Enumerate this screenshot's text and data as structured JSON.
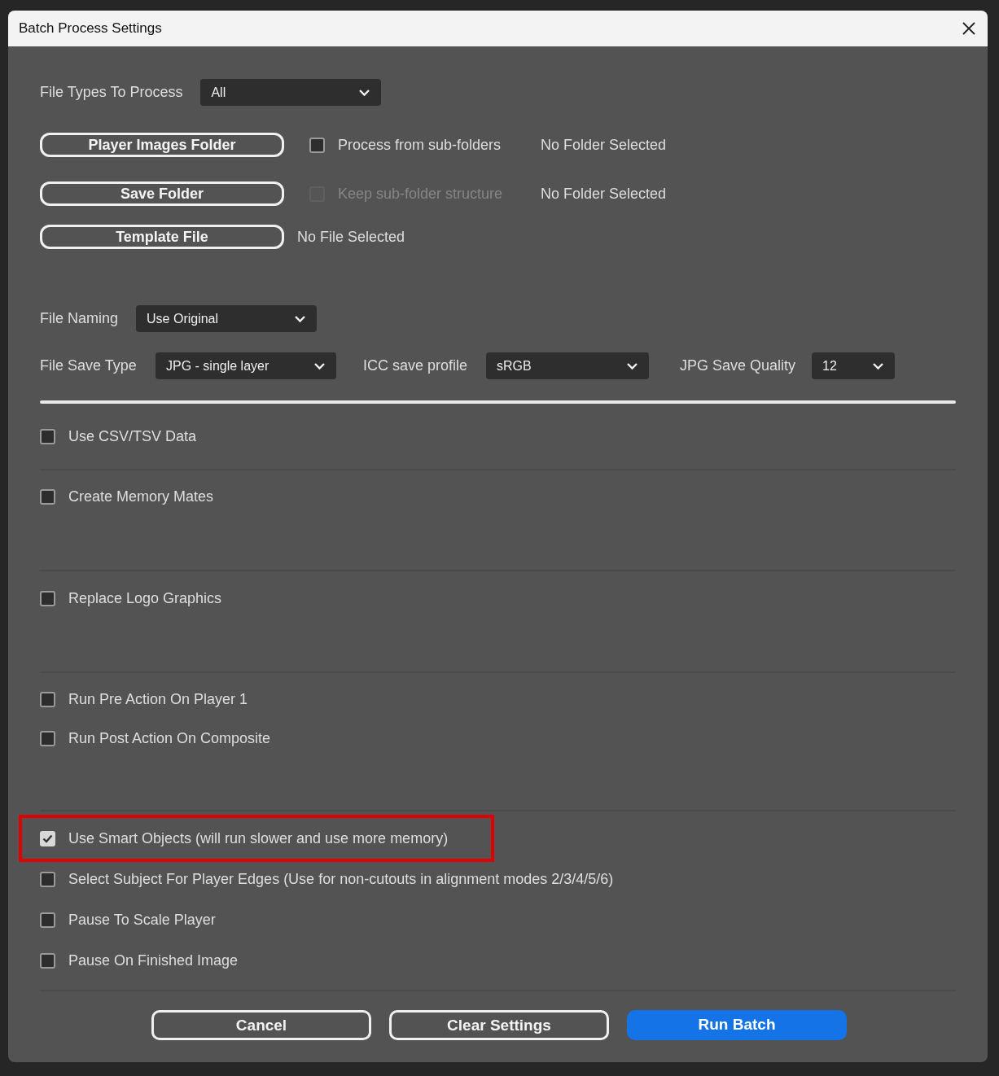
{
  "window": {
    "title": "Batch Process Settings"
  },
  "file_types": {
    "label": "File Types To Process",
    "value": "All"
  },
  "folder_rows": [
    {
      "button": "Player Images Folder",
      "checkbox": {
        "label": "Process from sub-folders",
        "checked": false,
        "disabled": false
      },
      "status": "No Folder Selected"
    },
    {
      "button": "Save Folder",
      "checkbox": {
        "label": "Keep sub-folder structure",
        "checked": false,
        "disabled": true
      },
      "status": "No Folder Selected"
    },
    {
      "button": "Template File",
      "status": "No File Selected"
    }
  ],
  "file_naming": {
    "label": "File Naming",
    "value": "Use Original"
  },
  "save_settings": [
    {
      "label": "File Save Type",
      "value": "JPG - single layer"
    },
    {
      "label": "ICC save profile",
      "value": "sRGB"
    },
    {
      "label": "JPG Save Quality",
      "value": "12"
    }
  ],
  "option_groups": [
    {
      "options": [
        {
          "label": "Use CSV/TSV Data",
          "checked": false,
          "highlighted": false
        }
      ]
    },
    {
      "options": [
        {
          "label": "Create Memory Mates",
          "checked": false,
          "highlighted": false
        }
      ]
    },
    {
      "options": [
        {
          "label": "Replace Logo Graphics",
          "checked": false,
          "highlighted": false
        }
      ]
    },
    {
      "options": [
        {
          "label": "Run Pre Action On Player 1",
          "checked": false,
          "highlighted": false
        },
        {
          "label": "Run Post Action On Composite",
          "checked": false,
          "highlighted": false
        }
      ]
    },
    {
      "options": [
        {
          "label": "Use Smart Objects (will run slower and use more memory)",
          "checked": true,
          "highlighted": true
        },
        {
          "label": "Select Subject For Player Edges (Use for non-cutouts in alignment modes 2/3/4/5/6)",
          "checked": false,
          "highlighted": false
        },
        {
          "label": "Pause To Scale Player",
          "checked": false,
          "highlighted": false
        },
        {
          "label": "Pause On Finished Image",
          "checked": false,
          "highlighted": false
        }
      ]
    }
  ],
  "buttons": [
    {
      "label": "Cancel",
      "kind": "outline"
    },
    {
      "label": "Clear Settings",
      "kind": "outline"
    },
    {
      "label": "Run Batch",
      "kind": "primary"
    }
  ]
}
